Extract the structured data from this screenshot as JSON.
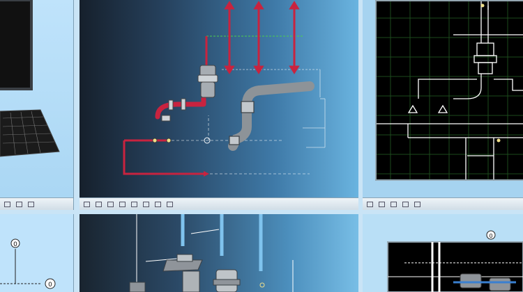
{
  "panels": {
    "main_view": {
      "marker_label": "0"
    },
    "bottom_left": {
      "markers": [
        "0",
        "0"
      ]
    },
    "bottom_right": {
      "marker_label": "0"
    }
  },
  "colors": {
    "pipe_red": "#c8233f",
    "pipe_grey": "#9aa0a6",
    "cad_line": "#ffffff",
    "cad_grid": "#1d4a1d",
    "guide_green": "#4ccf4c"
  },
  "icons": [
    "computer-monitor-icon",
    "keyboard-icon",
    "pipe-fitting-icon",
    "elbow-pipe-icon",
    "valve-icon"
  ]
}
